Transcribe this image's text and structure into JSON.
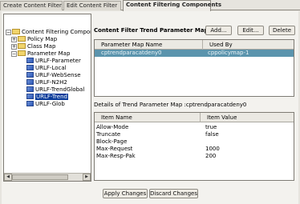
{
  "tabs": [
    {
      "label": "Create Content Filter"
    },
    {
      "label": "Edit Content Filter"
    },
    {
      "label": "Content Filtering Components"
    }
  ],
  "tree": {
    "items": [
      {
        "label": "Content Filtering Components",
        "exp": "−"
      },
      {
        "label": "Policy Map",
        "exp": "+"
      },
      {
        "label": "Class Map",
        "exp": "+"
      },
      {
        "label": "Parameter Map",
        "exp": "−"
      },
      {
        "label": "URLF-Parameter"
      },
      {
        "label": "URLF-Local"
      },
      {
        "label": "URLF-WebSense"
      },
      {
        "label": "URLF-N2H2"
      },
      {
        "label": "URLF-TrendGlobal"
      },
      {
        "label": "URLF-Trend"
      },
      {
        "label": "URLF-Glob"
      }
    ],
    "scroll_left": "◀",
    "scroll_right": "▶"
  },
  "param_map": {
    "title": "Content Filter Trend Parameter Map",
    "add_label": "Add...",
    "edit_label": "Edit...",
    "delete_label": "Delete",
    "columns": [
      "Parameter Map Name",
      "Used By"
    ],
    "rows": [
      {
        "name": "cptrendparacatdeny0",
        "used_by": "cppolicymap-1"
      }
    ]
  },
  "details": {
    "title": "Details of Trend Parameter Map :cptrendparacatdeny0",
    "columns": [
      "Item Name",
      "Item Value"
    ],
    "rows": [
      {
        "name": "Allow-Mode",
        "value": "true"
      },
      {
        "name": "Truncate",
        "value": "false"
      },
      {
        "name": "Block-Page",
        "value": ""
      },
      {
        "name": "Max-Request",
        "value": "1000"
      },
      {
        "name": "Max-Resp-Pak",
        "value": "200"
      }
    ]
  },
  "footer": {
    "apply_label": "Apply Changes",
    "discard_label": "Discard Changes"
  }
}
